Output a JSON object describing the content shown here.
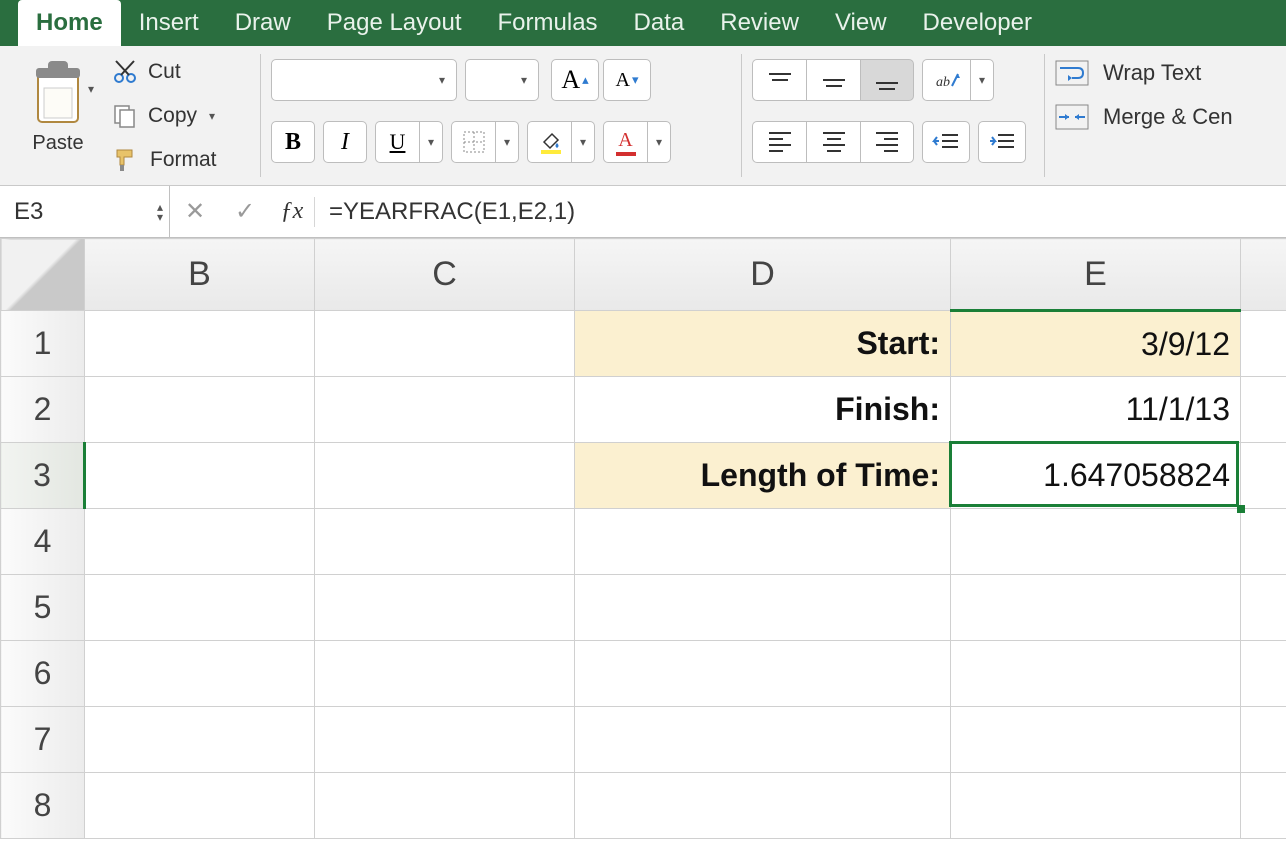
{
  "tabs": [
    "Home",
    "Insert",
    "Draw",
    "Page Layout",
    "Formulas",
    "Data",
    "Review",
    "View",
    "Developer"
  ],
  "active_tab": 0,
  "clipboard": {
    "paste": "Paste",
    "cut": "Cut",
    "copy": "Copy",
    "format": "Format"
  },
  "font": {
    "bold": "B",
    "italic": "I",
    "underline": "U",
    "bigA": "A",
    "smA": "A",
    "colorA": "A"
  },
  "wrap": {
    "wrap": "Wrap Text",
    "merge": "Merge & Cen"
  },
  "namebox": "E3",
  "formula": "=YEARFRAC(E1,E2,1)",
  "columns": [
    "B",
    "C",
    "D",
    "E"
  ],
  "rows": [
    "1",
    "2",
    "3",
    "4",
    "5",
    "6",
    "7",
    "8"
  ],
  "cells": {
    "D1": "Start:",
    "E1": "3/9/12",
    "D2": "Finish:",
    "E2": "11/1/13",
    "D3": "Length of Time:",
    "E3": "1.647058824"
  },
  "selected_cell": "E3"
}
